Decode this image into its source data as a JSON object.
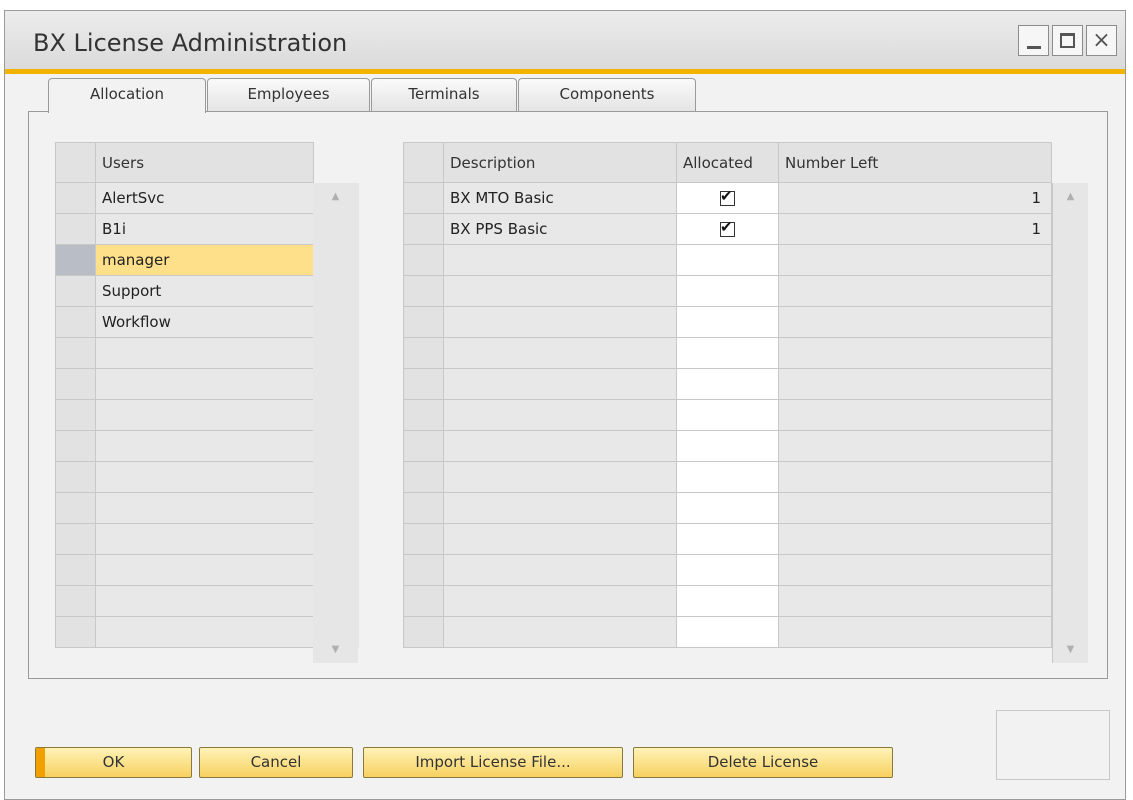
{
  "window": {
    "title": "BX License Administration",
    "accent_color": "#f3b400",
    "controls": {
      "minimize": "minimize-icon",
      "maximize": "maximize-icon",
      "close_glyph": "×"
    }
  },
  "tabs": [
    {
      "label": "Allocation",
      "active": true
    },
    {
      "label": "Employees",
      "active": false
    },
    {
      "label": "Terminals",
      "active": false
    },
    {
      "label": "Components",
      "active": false
    }
  ],
  "users_grid": {
    "header": "Users",
    "rows": [
      "AlertSvc",
      "B1i",
      "manager",
      "Support",
      "Workflow"
    ],
    "selected": "manager"
  },
  "license_grid": {
    "headers": {
      "description": "Description",
      "allocated": "Allocated",
      "number_left": "Number Left"
    },
    "rows": [
      {
        "description": "BX MTO Basic",
        "allocated": true,
        "number_left": "1"
      },
      {
        "description": "BX PPS Basic",
        "allocated": true,
        "number_left": "1"
      }
    ]
  },
  "buttons": {
    "ok": "OK",
    "cancel": "Cancel",
    "import": "Import License File...",
    "delete": "Delete License"
  },
  "colors": {
    "selection": "#ffe08a",
    "button_gradient_top": "#fff3b8",
    "button_gradient_bottom": "#f7d160",
    "button_accent": "#f0a000"
  }
}
